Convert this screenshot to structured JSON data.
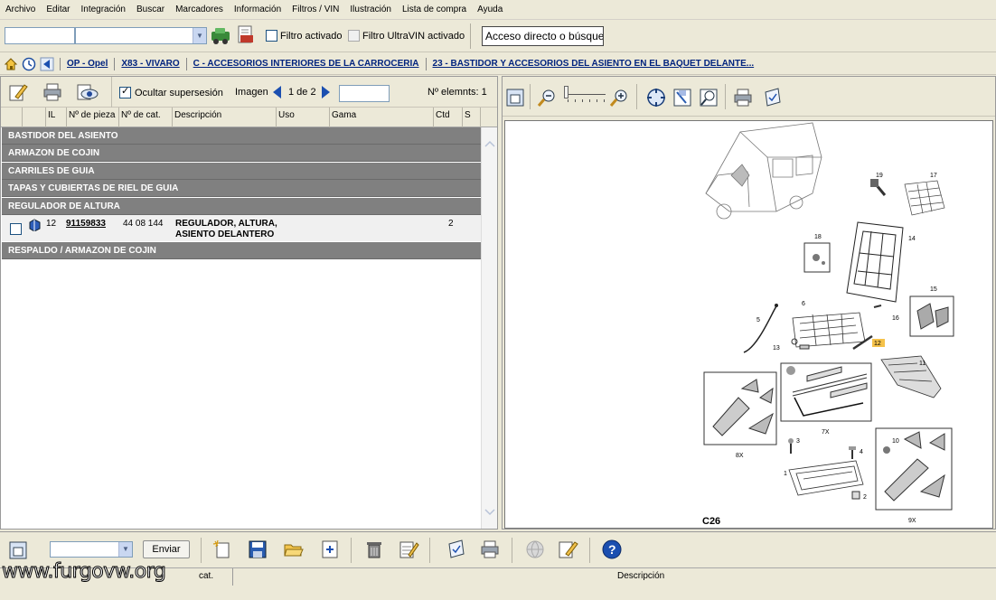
{
  "menu": [
    "Archivo",
    "Editar",
    "Integración",
    "Buscar",
    "Marcadores",
    "Información",
    "Filtros / VIN",
    "Ilustración",
    "Lista de compra",
    "Ayuda"
  ],
  "toolbar": {
    "filter_label": "Filtro activado",
    "ultravin_label": "Filtro UltraVIN activado",
    "quick_access_value": "Acceso directo o búsqued"
  },
  "breadcrumb": [
    "OP - Opel",
    "X83 - VIVARO",
    "C - ACCESORIOS INTERIORES DE LA CARROCERIA",
    "23 - BASTIDOR Y ACCESORIOS DEL ASIENTO EN EL BAQUET DELANTE..."
  ],
  "parts_toolbar": {
    "hide_supersession_label": "Ocultar supersesión",
    "image_label": "Imagen",
    "image_page": "1 de 2",
    "elements_label": "Nº elemnts: 1"
  },
  "columns": [
    "IL",
    "Nº de pieza",
    "Nº de cat.",
    "Descripción",
    "Uso",
    "Gama",
    "Ctd",
    "S"
  ],
  "groups": [
    "BASTIDOR DEL ASIENTO",
    "ARMAZON DE COJIN",
    "CARRILES DE GUIA",
    "TAPAS Y CUBIERTAS DE RIEL DE GUIA",
    "REGULADOR DE ALTURA",
    "RESPALDO / ARMAZON DE COJIN"
  ],
  "part_row": {
    "il": "12",
    "part_no": "91159833",
    "cat_no": "44 08 144",
    "desc_line1": "REGULADOR, ALTURA,",
    "desc_line2": "ASIENTO DELANTERO",
    "qty": "2"
  },
  "drawing": {
    "code": "C26",
    "callouts": [
      "19",
      "17",
      "18",
      "14",
      "15",
      "6",
      "5",
      "16",
      "12",
      "13",
      "11",
      "8X",
      "7X",
      "3",
      "4",
      "10",
      "1",
      "2",
      "9X"
    ]
  },
  "bottom": {
    "send_label": "Enviar"
  },
  "footer": {
    "cat_label": "cat.",
    "desc_label": "Descripción",
    "watermark": "www.furgovw.org"
  }
}
